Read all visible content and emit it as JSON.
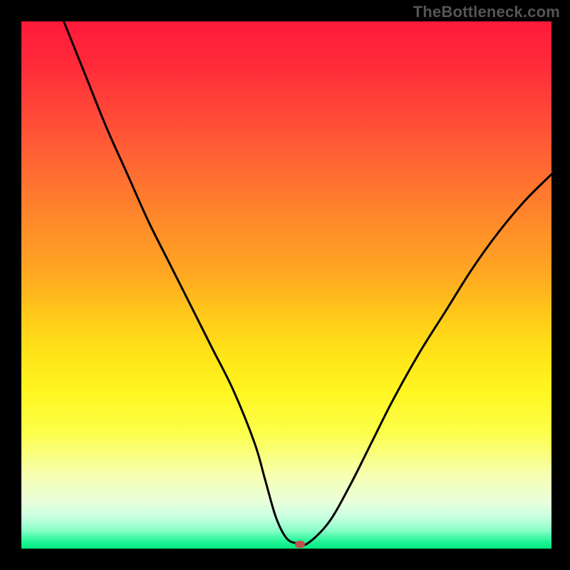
{
  "watermark": "TheBottleneck.com",
  "colors": {
    "background": "#000000",
    "curve": "#000000",
    "dot": "#c05048"
  },
  "chart_data": {
    "type": "line",
    "title": "",
    "xlabel": "",
    "ylabel": "",
    "xlim": [
      0,
      100
    ],
    "ylim": [
      0,
      100
    ],
    "grid": false,
    "series": [
      {
        "name": "curve",
        "x": [
          8,
          12,
          16,
          20,
          24,
          28,
          32,
          36,
          40,
          44,
          46,
          48,
          50,
          52,
          54,
          58,
          62,
          66,
          70,
          75,
          80,
          85,
          90,
          95,
          100
        ],
        "y": [
          100,
          90,
          80,
          71,
          62,
          54,
          46,
          38,
          30,
          20,
          13,
          6,
          2,
          1,
          1,
          5,
          12,
          20,
          28,
          37,
          45,
          53,
          60,
          66,
          71
        ]
      }
    ],
    "marker": {
      "x": 52.5,
      "y": 0.8
    },
    "gradient_stops": [
      {
        "pos": 0,
        "color": "#ff1a3a"
      },
      {
        "pos": 0.5,
        "color": "#ffb81e"
      },
      {
        "pos": 0.78,
        "color": "#fdff4a"
      },
      {
        "pos": 0.94,
        "color": "#c8ffe0"
      },
      {
        "pos": 1.0,
        "color": "#00e87f"
      }
    ]
  }
}
